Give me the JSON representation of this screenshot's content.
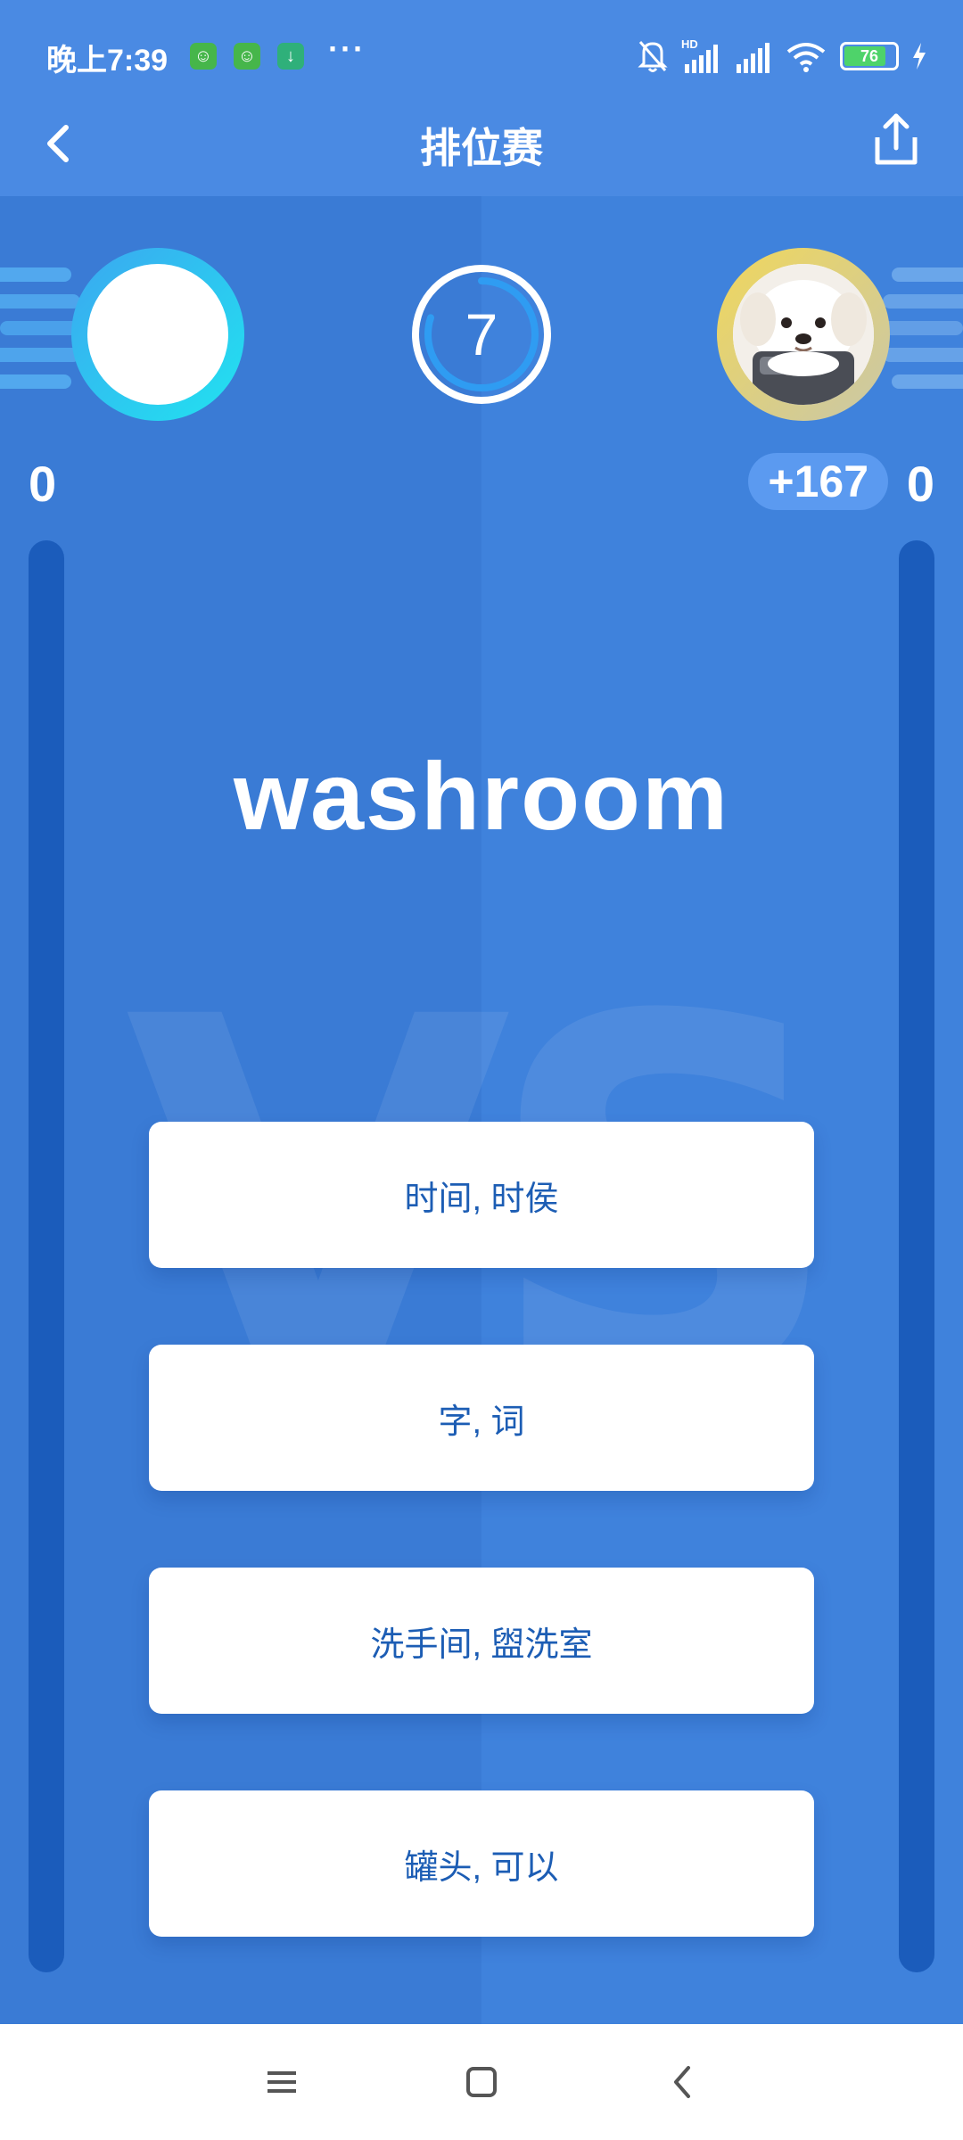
{
  "status_bar": {
    "time": "晚上7:39",
    "app_icons": [
      "cat-app-icon",
      "cat-app-icon",
      "download-icon"
    ],
    "overflow": "···",
    "battery_level": "76",
    "network_label": "HD"
  },
  "header": {
    "title": "排位赛",
    "back_icon": "chevron-left-icon",
    "share_icon": "share-icon"
  },
  "game": {
    "timer_value": "7",
    "timer_progress": 0.8,
    "left_player": {
      "score": "0"
    },
    "right_player": {
      "score": "0",
      "bonus": "+167"
    },
    "background_text": "VS",
    "word": "washroom",
    "options": [
      "时间, 时侯",
      "字, 词",
      "洗手间, 盥洗室",
      "罐头, 可以"
    ]
  },
  "colors": {
    "accent": "#3a7bd5",
    "header": "#4a8ae3",
    "option_text": "#1c5db4",
    "left_ring": "#21e3f0",
    "right_ring": "#f0d75c"
  },
  "navbar": {
    "icons": [
      "menu-icon",
      "home-square-icon",
      "back-triangle-icon"
    ]
  }
}
